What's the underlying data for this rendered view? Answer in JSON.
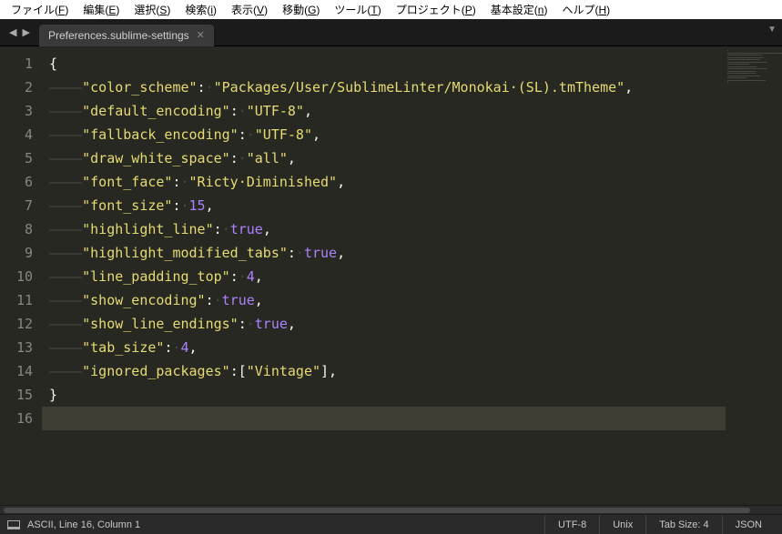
{
  "menubar": {
    "items": [
      {
        "label": "ファイル",
        "mn": "F"
      },
      {
        "label": "編集",
        "mn": "E"
      },
      {
        "label": "選択",
        "mn": "S"
      },
      {
        "label": "検索",
        "mn": "i"
      },
      {
        "label": "表示",
        "mn": "V"
      },
      {
        "label": "移動",
        "mn": "G"
      },
      {
        "label": "ツール",
        "mn": "T"
      },
      {
        "label": "プロジェクト",
        "mn": "P"
      },
      {
        "label": "基本設定",
        "mn": "n"
      },
      {
        "label": "ヘルプ",
        "mn": "H"
      }
    ]
  },
  "tab": {
    "title": "Preferences.sublime-settings"
  },
  "editor": {
    "active_line": 16,
    "lines": [
      {
        "n": 1,
        "segs": [
          {
            "t": "{",
            "c": "punct"
          }
        ]
      },
      {
        "n": 2,
        "segs": [
          {
            "t": "————",
            "c": "indent"
          },
          {
            "t": "\"color_scheme\"",
            "c": "key"
          },
          {
            "t": ":",
            "c": "punct"
          },
          {
            "t": "·",
            "c": "ws"
          },
          {
            "t": "\"Packages/User/SublimeLinter/Monokai·(SL).tmTheme\"",
            "c": "str"
          },
          {
            "t": ",",
            "c": "punct"
          }
        ]
      },
      {
        "n": 3,
        "segs": [
          {
            "t": "————",
            "c": "indent"
          },
          {
            "t": "\"default_encoding\"",
            "c": "key"
          },
          {
            "t": ":",
            "c": "punct"
          },
          {
            "t": "·",
            "c": "ws"
          },
          {
            "t": "\"UTF-8\"",
            "c": "str"
          },
          {
            "t": ",",
            "c": "punct"
          }
        ]
      },
      {
        "n": 4,
        "segs": [
          {
            "t": "————",
            "c": "indent"
          },
          {
            "t": "\"fallback_encoding\"",
            "c": "key"
          },
          {
            "t": ":",
            "c": "punct"
          },
          {
            "t": "·",
            "c": "ws"
          },
          {
            "t": "\"UTF-8\"",
            "c": "str"
          },
          {
            "t": ",",
            "c": "punct"
          }
        ]
      },
      {
        "n": 5,
        "segs": [
          {
            "t": "————",
            "c": "indent"
          },
          {
            "t": "\"draw_white_space\"",
            "c": "key"
          },
          {
            "t": ":",
            "c": "punct"
          },
          {
            "t": "·",
            "c": "ws"
          },
          {
            "t": "\"all\"",
            "c": "str"
          },
          {
            "t": ",",
            "c": "punct"
          }
        ]
      },
      {
        "n": 6,
        "segs": [
          {
            "t": "————",
            "c": "indent"
          },
          {
            "t": "\"font_face\"",
            "c": "key"
          },
          {
            "t": ":",
            "c": "punct"
          },
          {
            "t": "·",
            "c": "ws"
          },
          {
            "t": "\"Ricty·Diminished\"",
            "c": "str"
          },
          {
            "t": ",",
            "c": "punct"
          }
        ]
      },
      {
        "n": 7,
        "segs": [
          {
            "t": "————",
            "c": "indent"
          },
          {
            "t": "\"font_size\"",
            "c": "key"
          },
          {
            "t": ":",
            "c": "punct"
          },
          {
            "t": "·",
            "c": "ws"
          },
          {
            "t": "15",
            "c": "num"
          },
          {
            "t": ",",
            "c": "punct"
          }
        ]
      },
      {
        "n": 8,
        "segs": [
          {
            "t": "————",
            "c": "indent"
          },
          {
            "t": "\"highlight_line\"",
            "c": "key"
          },
          {
            "t": ":",
            "c": "punct"
          },
          {
            "t": "·",
            "c": "ws"
          },
          {
            "t": "true",
            "c": "bool"
          },
          {
            "t": ",",
            "c": "punct"
          }
        ]
      },
      {
        "n": 9,
        "segs": [
          {
            "t": "————",
            "c": "indent"
          },
          {
            "t": "\"highlight_modified_tabs\"",
            "c": "key"
          },
          {
            "t": ":",
            "c": "punct"
          },
          {
            "t": "·",
            "c": "ws"
          },
          {
            "t": "true",
            "c": "bool"
          },
          {
            "t": ",",
            "c": "punct"
          }
        ]
      },
      {
        "n": 10,
        "segs": [
          {
            "t": "————",
            "c": "indent"
          },
          {
            "t": "\"line_padding_top\"",
            "c": "key"
          },
          {
            "t": ":",
            "c": "punct"
          },
          {
            "t": "·",
            "c": "ws"
          },
          {
            "t": "4",
            "c": "num"
          },
          {
            "t": ",",
            "c": "punct"
          }
        ]
      },
      {
        "n": 11,
        "segs": [
          {
            "t": "————",
            "c": "indent"
          },
          {
            "t": "\"show_encoding\"",
            "c": "key"
          },
          {
            "t": ":",
            "c": "punct"
          },
          {
            "t": "·",
            "c": "ws"
          },
          {
            "t": "true",
            "c": "bool"
          },
          {
            "t": ",",
            "c": "punct"
          }
        ]
      },
      {
        "n": 12,
        "segs": [
          {
            "t": "————",
            "c": "indent"
          },
          {
            "t": "\"show_line_endings\"",
            "c": "key"
          },
          {
            "t": ":",
            "c": "punct"
          },
          {
            "t": "·",
            "c": "ws"
          },
          {
            "t": "true",
            "c": "bool"
          },
          {
            "t": ",",
            "c": "punct"
          }
        ]
      },
      {
        "n": 13,
        "segs": [
          {
            "t": "————",
            "c": "indent"
          },
          {
            "t": "\"tab_size\"",
            "c": "key"
          },
          {
            "t": ":",
            "c": "punct"
          },
          {
            "t": "·",
            "c": "ws"
          },
          {
            "t": "4",
            "c": "num"
          },
          {
            "t": ",",
            "c": "punct"
          }
        ]
      },
      {
        "n": 14,
        "segs": [
          {
            "t": "————",
            "c": "indent"
          },
          {
            "t": "\"ignored_packages\"",
            "c": "key"
          },
          {
            "t": ":[",
            "c": "punct"
          },
          {
            "t": "\"Vintage\"",
            "c": "str"
          },
          {
            "t": "],",
            "c": "punct"
          }
        ]
      },
      {
        "n": 15,
        "segs": [
          {
            "t": "}",
            "c": "punct"
          }
        ]
      },
      {
        "n": 16,
        "segs": []
      }
    ]
  },
  "status": {
    "left": "ASCII, Line 16, Column 1",
    "encoding": "UTF-8",
    "line_endings": "Unix",
    "tab_size": "Tab Size: 4",
    "syntax": "JSON"
  }
}
